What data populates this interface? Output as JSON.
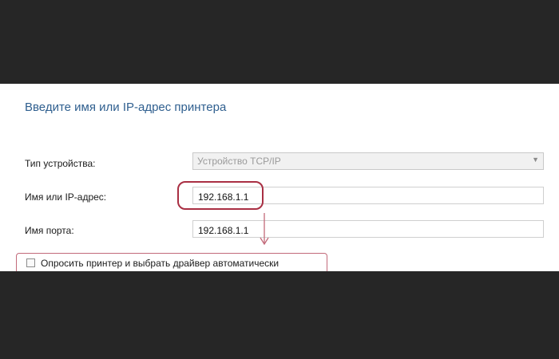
{
  "dialog": {
    "title": "Введите имя или IP-адрес принтера",
    "device_type": {
      "label": "Тип устройства:",
      "value": "Устройство TCP/IP"
    },
    "host": {
      "label": "Имя или IP-адрес:",
      "value": "192.168.1.1"
    },
    "port": {
      "label": "Имя порта:",
      "value": "192.168.1.1"
    },
    "auto_driver": {
      "label": "Опросить принтер и выбрать драйвер автоматически",
      "checked": false
    }
  },
  "annotations": {
    "highlight_color": "#a92f43",
    "arrow_color": "#c26a7a"
  }
}
